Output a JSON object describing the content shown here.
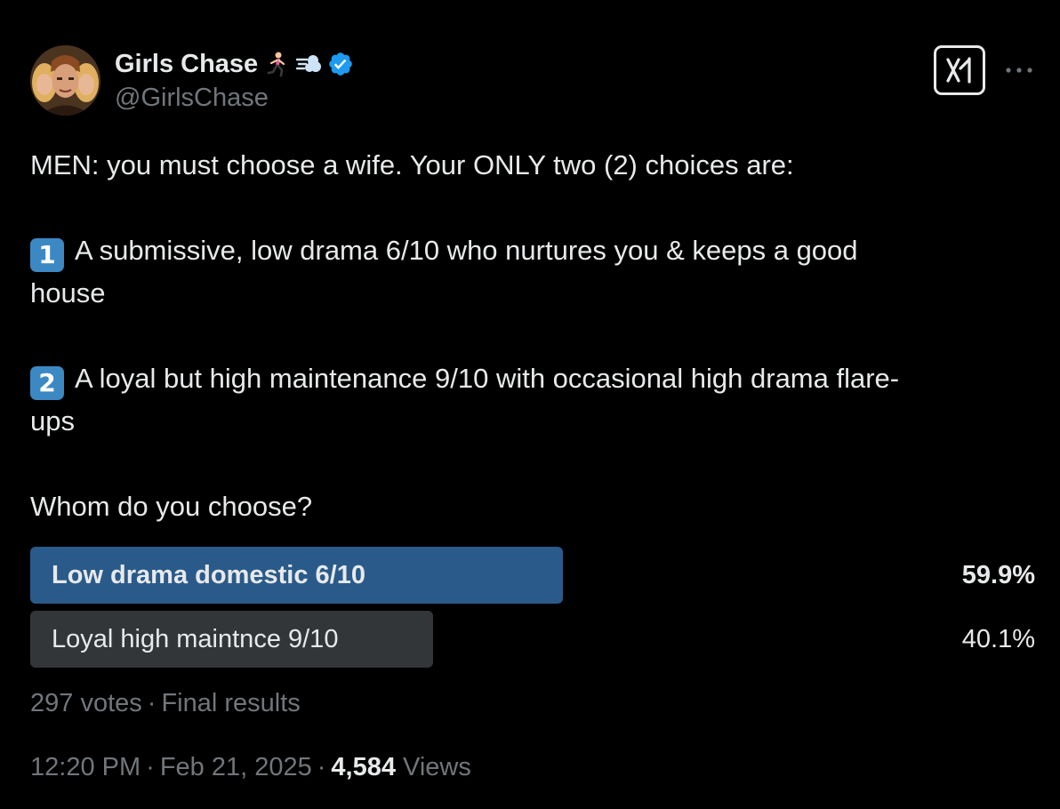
{
  "author": {
    "name": "Girls Chase",
    "handle": "@GirlsChase",
    "name_emojis": [
      "woman-running-icon",
      "dash-icon"
    ],
    "verified": true
  },
  "actions": {
    "grok_icon": "grok-icon",
    "more_icon": "more-icon"
  },
  "tweet": {
    "line_intro": "MEN: you must choose a wife. Your ONLY two (2) choices are:",
    "option1_keycap": "1",
    "option1_line1": "A submissive, low drama 6/10 who nurtures you & keeps a good",
    "option1_line2": "house",
    "option2_keycap": "2",
    "option2_line1": "A loyal but high maintenance 9/10 with occasional high drama flare-",
    "option2_line2": "ups",
    "question": "Whom do you choose?"
  },
  "poll": {
    "options": [
      {
        "label": "Low drama domestic 6/10",
        "percent_text": "59.9%",
        "percent": 59.9,
        "winner": true
      },
      {
        "label": "Loyal high maintnce 9/10",
        "percent_text": "40.1%",
        "percent": 40.1,
        "winner": false
      }
    ],
    "votes": "297 votes",
    "separator": "·",
    "status": "Final results"
  },
  "meta": {
    "time": "12:20 PM",
    "separator": "·",
    "date": "Feb 21, 2025",
    "views_count": "4,584",
    "views_label": "Views"
  },
  "colors": {
    "background": "#000000",
    "text_primary": "#e7e9ea",
    "text_secondary": "#71767b",
    "verified_blue": "#1d9bf0",
    "poll_winner": "#2a5a8a",
    "poll_other": "#333639",
    "keycap_blue": "#3b88c3"
  }
}
